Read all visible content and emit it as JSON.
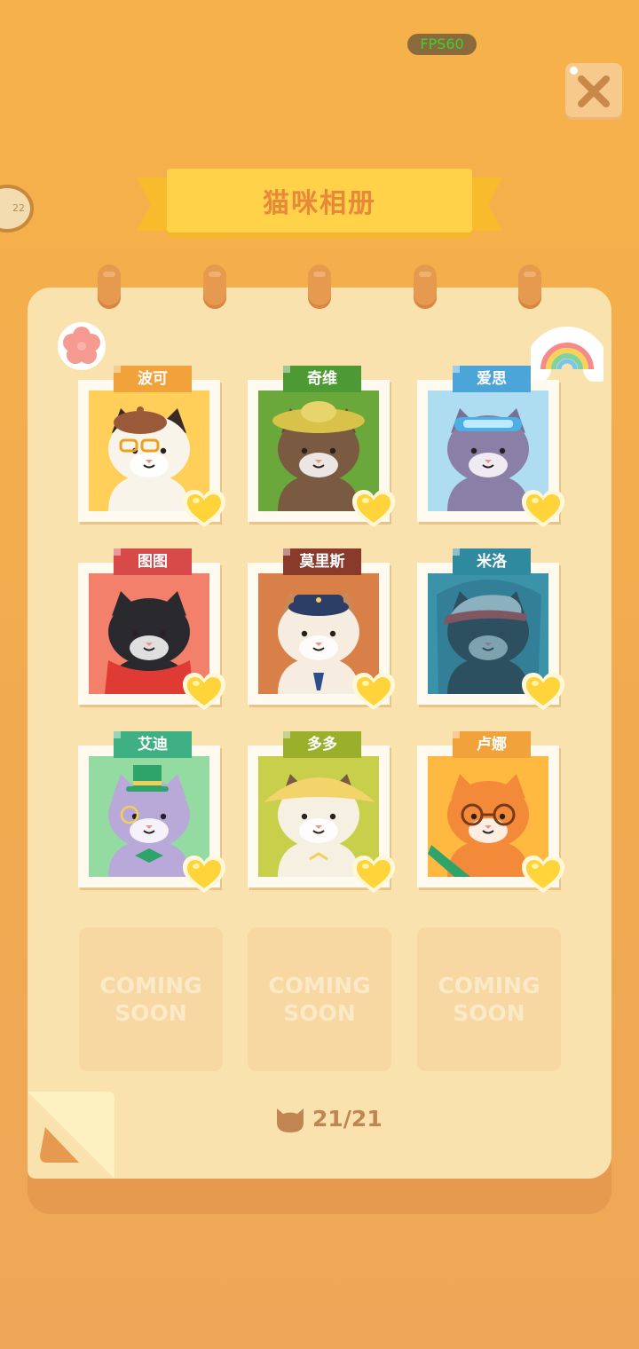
{
  "hud": {
    "fps": "FPS60",
    "side_badge": "22"
  },
  "title": "猫咪相册",
  "cats": [
    {
      "name": "波可",
      "tag_color": "#f2a23a",
      "bg": "#ffcf5a",
      "fur": "#f8f4ea",
      "ears": "#3a2a24",
      "accent": "#e8893a",
      "acc": "beret"
    },
    {
      "name": "奇维",
      "tag_color": "#4d9a35",
      "bg": "#6aa83c",
      "fur": "#7a5a40",
      "ears": "#6a4a32",
      "accent": "#f1cf6a",
      "acc": "hat"
    },
    {
      "name": "爱思",
      "tag_color": "#4ba5d9",
      "bg": "#aedcf0",
      "fur": "#8a7fa6",
      "ears": "#7a6f96",
      "accent": "#5ab8e8",
      "acc": "goggles"
    },
    {
      "name": "图图",
      "tag_color": "#d84a4a",
      "bg": "#f3806b",
      "fur": "#2a2a2e",
      "ears": "#2a2a2e",
      "accent": "#e03a34",
      "acc": "scarf"
    },
    {
      "name": "莫里斯",
      "tag_color": "#8a3a2a",
      "bg": "#d98049",
      "fur": "#f6ece0",
      "ears": "#c88a5a",
      "accent": "#2c3e66",
      "acc": "captain"
    },
    {
      "name": "米洛",
      "tag_color": "#2f8aa0",
      "bg": "#3a93a8",
      "fur": "#2a2a2e",
      "ears": "#2a2a2e",
      "accent": "#e03a34",
      "acc": "cap"
    },
    {
      "name": "艾迪",
      "tag_color": "#3fb083",
      "bg": "#93dba0",
      "fur": "#b9a9d8",
      "ears": "#b9a9d8",
      "accent": "#2ea36a",
      "acc": "tophat"
    },
    {
      "name": "多多",
      "tag_color": "#9ab02a",
      "bg": "#c8cf4a",
      "fur": "#f6f0e2",
      "ears": "#7a5a40",
      "accent": "#f3cf5a",
      "acc": "straw"
    },
    {
      "name": "卢娜",
      "tag_color": "#f2a23a",
      "bg": "#ffb941",
      "fur": "#f38a3a",
      "ears": "#f38a3a",
      "accent": "#2ea36a",
      "acc": "glasses"
    }
  ],
  "coming_soon": [
    {
      "line1": "COMING",
      "line2": "SOON"
    },
    {
      "line1": "COMING",
      "line2": "SOON"
    },
    {
      "line1": "COMING",
      "line2": "SOON"
    }
  ],
  "progress": {
    "text": "21/21",
    "collected": 21,
    "total": 21
  }
}
